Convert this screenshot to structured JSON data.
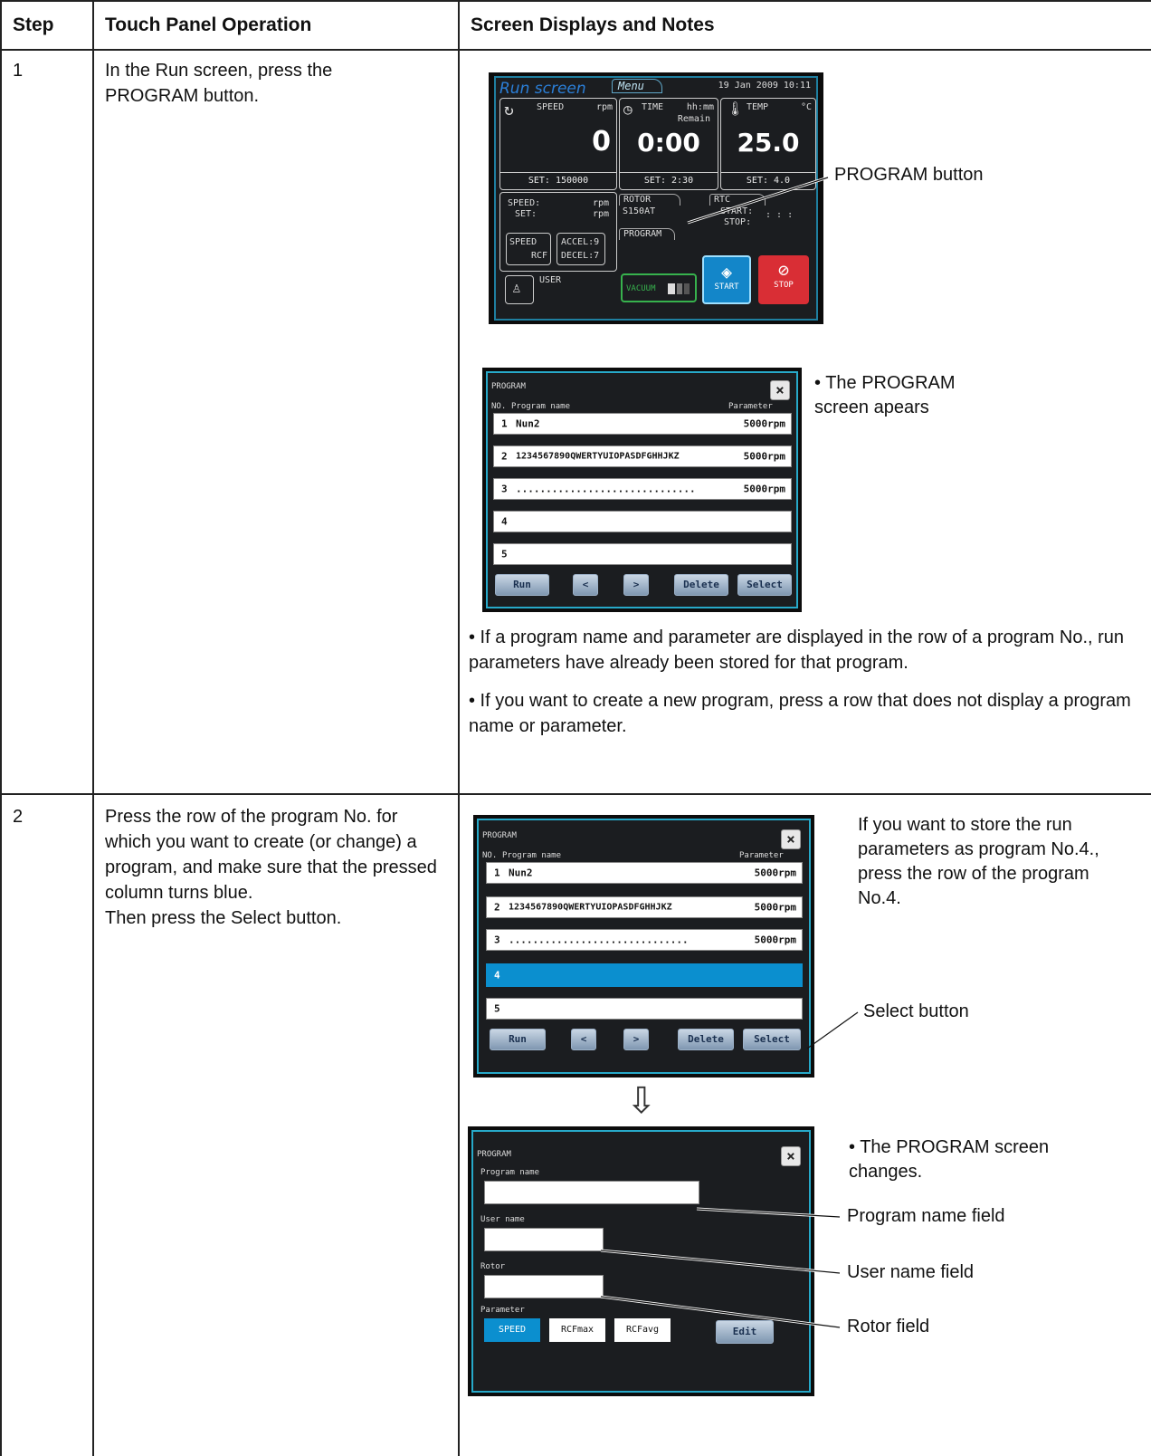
{
  "table": {
    "headers": [
      "Step",
      "Touch Panel Operation",
      "Screen Displays and Notes"
    ],
    "rows": [
      {
        "step": "1",
        "operation": "In the Run screen, press the PROGRAM button.",
        "notes": [
          "• If a program name and parameter are displayed in the row of a program No., run parameters have already been stored for that program.",
          "• If you want to create a new program, press a row that does not display a program name or parameter."
        ]
      },
      {
        "step": "2",
        "operation": "Press the row of the program No. for which you want to create (or change) a program, and make sure that the pressed column turns blue.\nThen press the Select button."
      }
    ]
  },
  "run_screen": {
    "title": "Run screen",
    "menu_tab": "Menu",
    "datetime": "19 Jan 2009 10:11",
    "speed_label": "SPEED",
    "speed_unit": "rpm",
    "speed_value": "0",
    "speed_set": "SET: 150000",
    "time_label": "TIME",
    "time_unit": "hh:mm",
    "time_sub": "Remain",
    "time_value": "0:00",
    "time_set": "SET: 2:30",
    "temp_label": "TEMP",
    "temp_unit": "°C",
    "temp_value": "25.0",
    "temp_set": "SET: 4.0",
    "speed_small": "SPEED:",
    "set_small": "SET:",
    "rpm": "rpm",
    "rotor_tab": "ROTOR",
    "rotor_value": "S150AT",
    "rtc_tab": "RTC",
    "rtc_start": "START:",
    "rtc_stop": "STOP:",
    "rtc_colons": ": : :",
    "program_tab": "PROGRAM",
    "speed_rcf_a": "SPEED",
    "speed_rcf_b": "RCF",
    "accel": "ACCEL:9",
    "decel": "DECEL:7",
    "user": "USER",
    "vacuum": "VACUUM",
    "start": "START",
    "stop": "STOP"
  },
  "program_list": {
    "title": "PROGRAM",
    "col_no": "NO.",
    "col_name": "Program name",
    "col_param": "Parameter",
    "rows": [
      {
        "no": "1",
        "name": "Nun2",
        "param": "5000rpm"
      },
      {
        "no": "2",
        "name": "1234567890QWERTYUIOPASDFGHHJKZ",
        "param": "5000rpm"
      },
      {
        "no": "3",
        "name": "..............................",
        "param": "5000rpm"
      },
      {
        "no": "4",
        "name": "",
        "param": ""
      },
      {
        "no": "5",
        "name": "",
        "param": ""
      }
    ],
    "buttons": {
      "run": "Run",
      "prev": "<",
      "next": ">",
      "delete": "Delete",
      "select": "Select"
    },
    "close": "×"
  },
  "program_edit": {
    "title": "PROGRAM",
    "program_name_label": "Program name",
    "user_name_label": "User name",
    "rotor_label": "Rotor",
    "parameter_label": "Parameter",
    "speed_btn": "SPEED",
    "rcfmax_btn": "RCFmax",
    "rcfavg_btn": "RCFavg",
    "edit_btn": "Edit",
    "close": "×"
  },
  "annotations": {
    "program_button": "PROGRAM button",
    "program_screen_appears": "• The PROGRAM screen apears",
    "store_hint": "If you want to store the run parameters as program No.4., press the row of the program No.4.",
    "select_button": "Select button",
    "screen_changes": "• The PROGRAM screen changes.",
    "program_name_field": "Program name field",
    "user_name_field": "User name field",
    "rotor_field": "Rotor field",
    "arrow": "⇩"
  }
}
